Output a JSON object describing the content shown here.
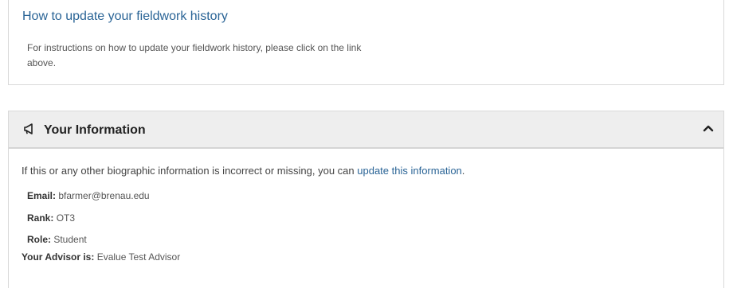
{
  "fieldwork": {
    "link_label": "How to update your fieldwork history",
    "description": "For instructions on how to update your fieldwork history, please click on the link above."
  },
  "info_panel": {
    "title": "Your Information",
    "header_icon": "megaphone-icon",
    "toggle_icon": "chevron-up-icon",
    "intro_prefix": "If this or any other biographic information is incorrect or missing, you can ",
    "intro_link": "update this information",
    "intro_suffix": ".",
    "fields": {
      "email_label": "Email:",
      "email_value": "bfarmer@brenau.edu",
      "rank_label": "Rank:",
      "rank_value": "OT3",
      "role_label": "Role:",
      "role_value": "Student",
      "advisor_label": "Your Advisor is:",
      "advisor_value": "Evalue Test Advisor"
    }
  },
  "colors": {
    "link": "#2a6496",
    "header_bg": "#eeeeee",
    "border": "#d9d9d9"
  }
}
